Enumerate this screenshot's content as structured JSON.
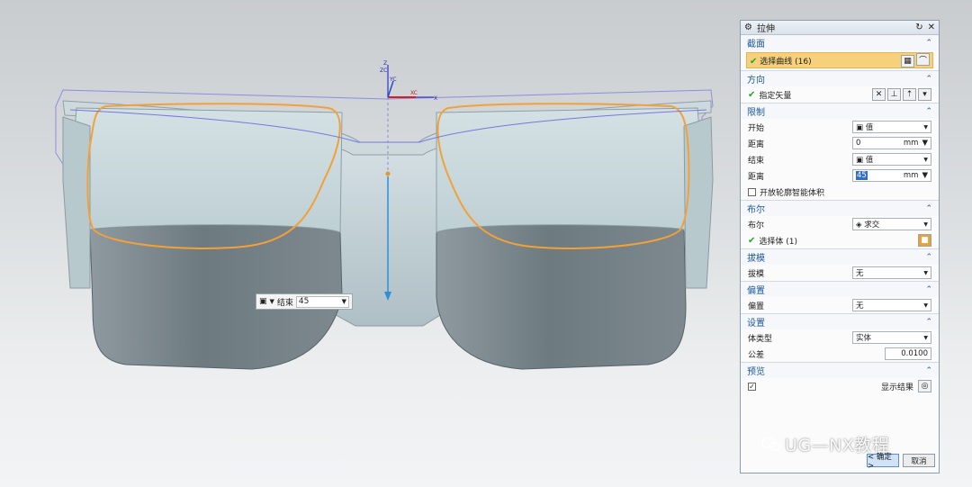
{
  "viewport": {
    "axis_labels": {
      "z": "Z",
      "zc": "ZC",
      "yc": "YC",
      "xc": "XC",
      "x": "X"
    },
    "float_input": {
      "icon": "value-cube-icon",
      "label": "结束",
      "value": "45"
    },
    "colors": {
      "body": "#7d8a90",
      "glass": "#c2d3d8",
      "outline": "#f3a23a",
      "wire": "#7f7fe0",
      "vector": "#2f8fd5"
    }
  },
  "dialog": {
    "title": "拉伸",
    "sections": {
      "section": {
        "title": "截面",
        "select_curve": "选择曲线 (16)"
      },
      "direction": {
        "title": "方向",
        "specify_vector": "指定矢量"
      },
      "limits": {
        "title": "限制",
        "start_label": "开始",
        "start_value": "值",
        "distance1_label": "距离",
        "distance1_value": "0",
        "distance1_unit": "mm",
        "end_label": "结束",
        "end_value": "值",
        "distance2_label": "距离",
        "distance2_value": "45",
        "distance2_unit": "mm",
        "open_profile": "开放轮廓智能体积"
      },
      "boolean": {
        "title": "布尔",
        "boolean_label": "布尔",
        "boolean_value": "求交",
        "select_body": "选择体 (1)"
      },
      "draft": {
        "title": "拔模",
        "draft_label": "拔模",
        "draft_value": "无"
      },
      "offset": {
        "title": "偏置",
        "offset_label": "偏置",
        "offset_value": "无"
      },
      "settings": {
        "title": "设置",
        "body_type_label": "体类型",
        "body_type_value": "实体",
        "tolerance_label": "公差",
        "tolerance_value": "0.0100"
      },
      "preview": {
        "title": "预览",
        "result_label": "显示结果"
      }
    },
    "ok": "< 确定 >",
    "cancel": "取消"
  },
  "watermark": "UG—NX教程"
}
